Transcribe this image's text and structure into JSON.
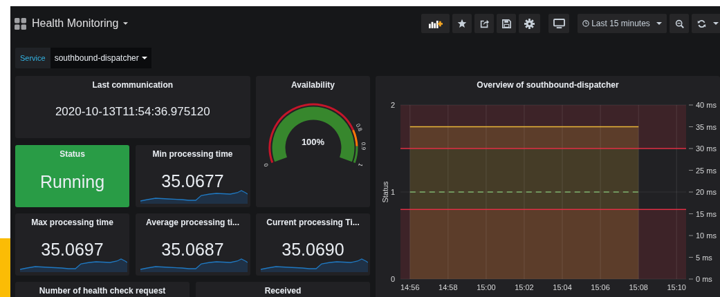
{
  "dashboard": {
    "title": "Health Monitoring"
  },
  "toolbar": {
    "time_range": "Last 15 minutes"
  },
  "variables": [
    {
      "label": "Service",
      "value": "southbound-dispatcher"
    }
  ],
  "panels": [
    {
      "kind": "text",
      "title": "Last communication",
      "value": "2020-10-13T11:54:36.975120"
    },
    {
      "kind": "gauge",
      "title": "Availability",
      "value": "100%",
      "ticks": [
        "0",
        "0.8",
        "0.9",
        "1"
      ]
    },
    {
      "kind": "graph",
      "title": "Overview of southbound-dispatcher",
      "chart_data": {
        "type": "line",
        "ylabel": "Status",
        "categories": [
          "14:56",
          "14:58",
          "15:00",
          "15:02",
          "15:04",
          "15:06",
          "15:08",
          "15:10"
        ],
        "series": [
          {
            "axis": "y2",
            "type": "area",
            "color": "#eab839",
            "values": [
              35,
              35,
              35,
              35,
              35,
              35,
              35,
              null
            ]
          },
          {
            "color": "#7eb26d",
            "line_style": "dashed",
            "values": [
              1,
              1,
              1,
              1,
              1,
              1,
              1,
              null
            ]
          }
        ],
        "grid": true,
        "ylim": [
          0,
          2
        ],
        "yticks": [
          0,
          1,
          2
        ],
        "y2lim": [
          0,
          40
        ],
        "y2ticks": [
          {
            "value": 0,
            "label": "0 ms"
          },
          {
            "value": 5,
            "label": "5 ms"
          },
          {
            "value": 10,
            "label": "10 ms"
          },
          {
            "value": 15,
            "label": "15 ms"
          },
          {
            "value": 20,
            "label": "20 ms"
          },
          {
            "value": 25,
            "label": "25 ms"
          },
          {
            "value": 30,
            "label": "30 ms"
          },
          {
            "value": 35,
            "label": "35 ms"
          },
          {
            "value": 40,
            "label": "40 ms"
          }
        ],
        "ref_lines": [
          {
            "value": 30,
            "axis": "y2",
            "color": "#e02f44"
          },
          {
            "value": 16,
            "axis": "y2",
            "color": "#e02f44"
          }
        ],
        "bands": [
          {
            "from": 30,
            "to": 40,
            "axis": "y2",
            "color": "#e02f44"
          },
          {
            "from": 0,
            "to": 16,
            "axis": "y2",
            "color": "#e02f44"
          }
        ]
      }
    },
    {
      "kind": "status",
      "title": "Status",
      "value": "Running"
    },
    {
      "kind": "stat",
      "title": "Min processing time",
      "value": "35.0677"
    },
    {
      "kind": "stat",
      "title": "Max processing time",
      "value": "35.0697"
    },
    {
      "kind": "stat",
      "title": "Average processing ti...",
      "value": "35.0687"
    },
    {
      "kind": "stat",
      "title": "Current processing Ti...",
      "value": "35.0690"
    },
    {
      "kind": "header",
      "title": "Number of health check request"
    },
    {
      "kind": "header",
      "title": "Received"
    }
  ]
}
